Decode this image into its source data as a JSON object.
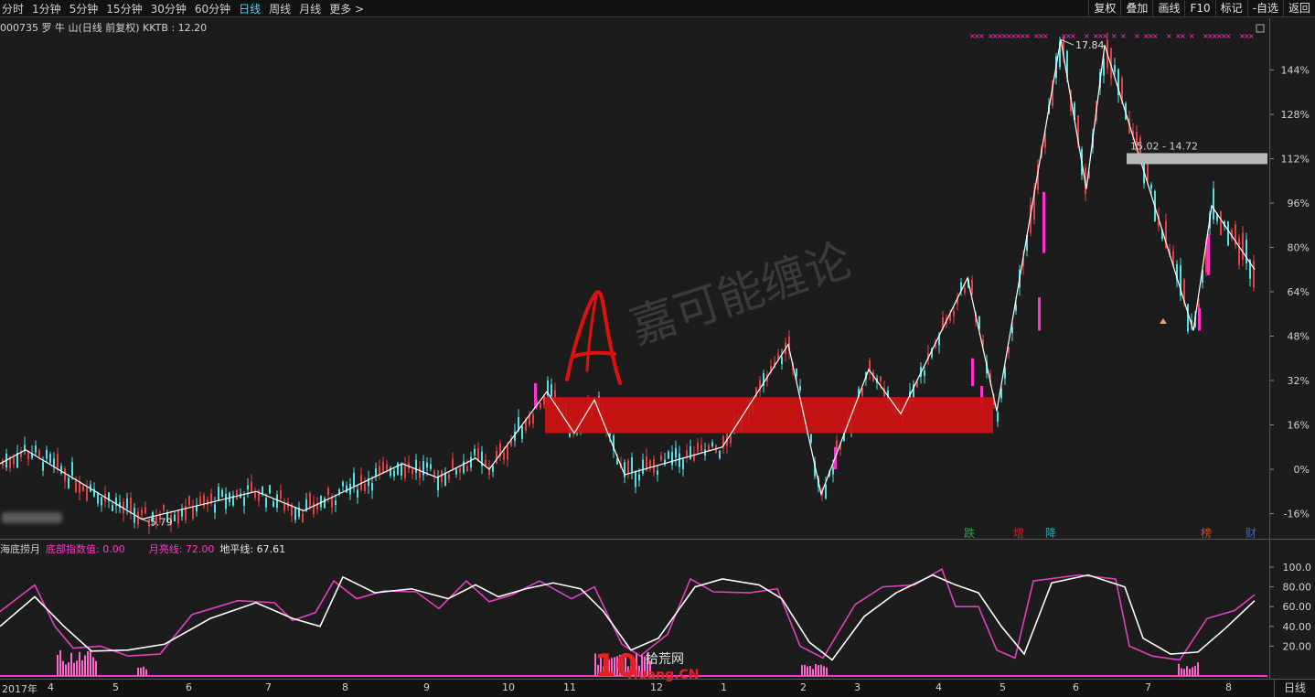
{
  "toolbar": {
    "tabs": [
      "分时",
      "1分钟",
      "5分钟",
      "15分钟",
      "30分钟",
      "60分钟",
      "日线",
      "周线",
      "月线",
      "更多 >"
    ],
    "active_tab": "日线",
    "right_buttons": [
      "复权",
      "叠加",
      "画线",
      "F10",
      "标记",
      "-自选",
      "返回"
    ]
  },
  "stock_info": "000735 罗 牛 山(日线 前复权) KKTB : 12.20",
  "watermark": "嘉可能缠论",
  "annotation_letter": "A",
  "price_labels": {
    "peak": "17.84",
    "low": "5.79",
    "resistance_band": "15.02 - 14.72"
  },
  "y_axis_labels": [
    "144%",
    "128%",
    "112%",
    "96%",
    "80%",
    "64%",
    "48%",
    "32%",
    "16%",
    "0%",
    "-16%"
  ],
  "event_markers": [
    {
      "label": "跌",
      "color": "#2ea84a"
    },
    {
      "label": "增",
      "color": "#d02020"
    },
    {
      "label": "降",
      "color": "#2aa3b0"
    },
    {
      "label": "榜",
      "color": "#c85020"
    },
    {
      "label": "财",
      "color": "#2a70c0"
    }
  ],
  "indicator": {
    "name": "海底捞月",
    "bottom_label": "底部指数值: 0.00",
    "month_line_label": "月亮线: 72.00",
    "horizon_label": "地平线: 67.61",
    "y_labels": [
      "100.0",
      "80.00",
      "60.00",
      "40.00",
      "20.00"
    ]
  },
  "x_axis_labels": [
    "2017年",
    "4",
    "5",
    "6",
    "7",
    "8",
    "9",
    "10",
    "11",
    "12",
    "1",
    "2",
    "3",
    "4",
    "5",
    "6",
    "7",
    "8"
  ],
  "period_label": "日线",
  "logo": {
    "number": "10",
    "site": "拾荒网",
    "domain": "Huang.CN"
  },
  "colors": {
    "up": "#e74040",
    "down": "#54e0e6",
    "accent": "#ff33cc",
    "highlight_band": "#cc1212",
    "resistance_band": "#b8b8b8"
  }
}
